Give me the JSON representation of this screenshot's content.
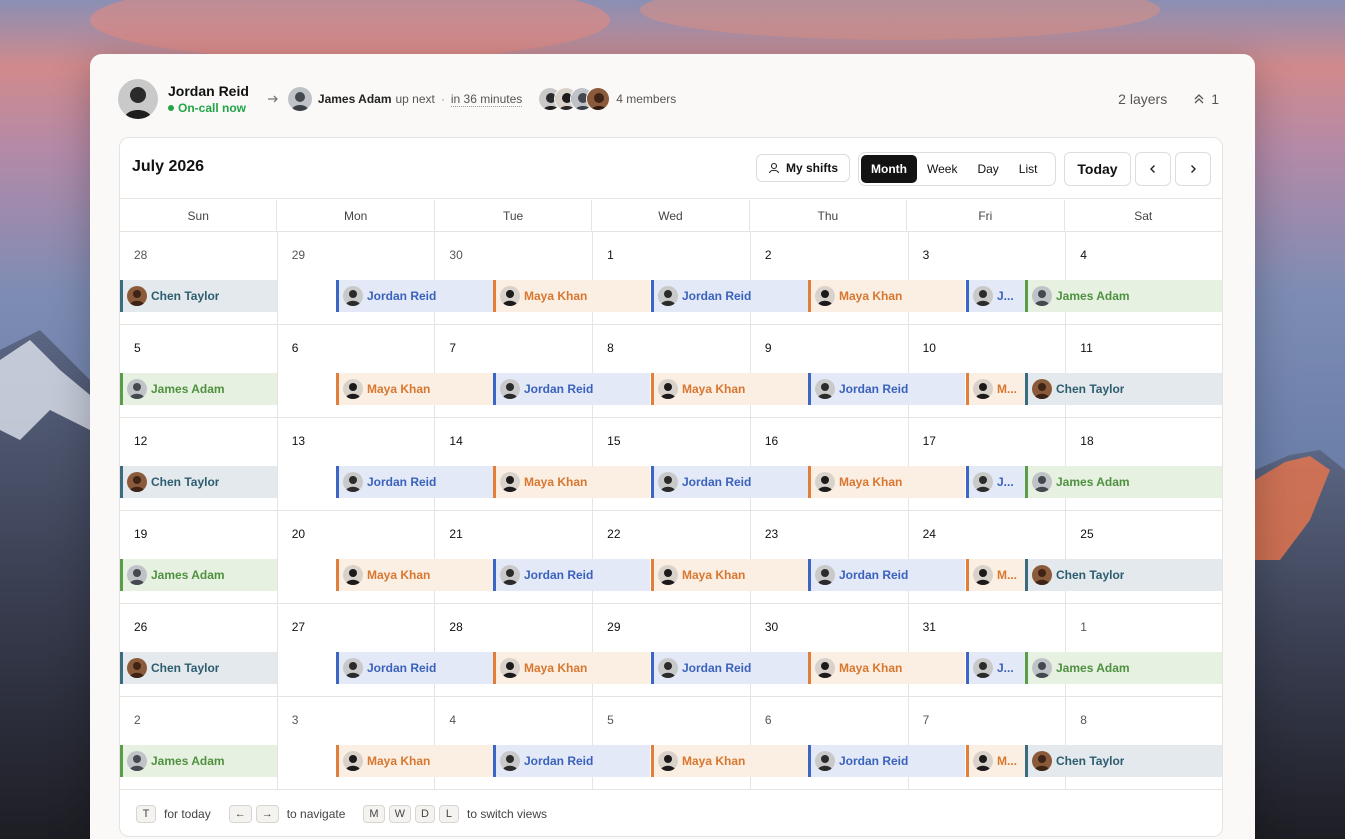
{
  "oncall": {
    "name": "Jordan Reid",
    "status": "On-call now",
    "next_name": "James Adam",
    "next_suffix": "up next",
    "next_sep": "·",
    "next_time": "in 36 minutes",
    "members_label": "4 members",
    "layers_label": "2 layers",
    "escalation_count": "1"
  },
  "calendar": {
    "month_label": "July 2026",
    "my_shifts_label": "My shifts",
    "views": [
      "Month",
      "Week",
      "Day",
      "List"
    ],
    "active_view": "Month",
    "today_label": "Today",
    "weekdays": [
      "Sun",
      "Mon",
      "Tue",
      "Wed",
      "Thu",
      "Fri",
      "Sat"
    ],
    "weeks": [
      {
        "days": [
          "28",
          "29",
          "30",
          "1",
          "2",
          "3",
          "4"
        ],
        "muted": [
          true,
          true,
          true,
          false,
          false,
          false,
          false
        ],
        "shifts": [
          [
            "chen",
            "Chen Taylor"
          ],
          [
            "jordan",
            "Jordan Reid"
          ],
          [
            "maya",
            "Maya Khan"
          ],
          [
            "jordan",
            "Jordan Reid"
          ],
          [
            "maya",
            "Maya Khan"
          ],
          [
            "jordan",
            "J..."
          ],
          [
            "james",
            "James Adam"
          ]
        ]
      },
      {
        "days": [
          "5",
          "6",
          "7",
          "8",
          "9",
          "10",
          "11"
        ],
        "muted": [
          false,
          false,
          false,
          false,
          false,
          false,
          false
        ],
        "shifts": [
          [
            "james",
            "James Adam"
          ],
          [
            "maya",
            "Maya Khan"
          ],
          [
            "jordan",
            "Jordan Reid"
          ],
          [
            "maya",
            "Maya Khan"
          ],
          [
            "jordan",
            "Jordan Reid"
          ],
          [
            "maya",
            "M..."
          ],
          [
            "chen",
            "Chen Taylor"
          ]
        ]
      },
      {
        "days": [
          "12",
          "13",
          "14",
          "15",
          "16",
          "17",
          "18"
        ],
        "muted": [
          false,
          false,
          false,
          false,
          false,
          false,
          false
        ],
        "shifts": [
          [
            "chen",
            "Chen Taylor"
          ],
          [
            "jordan",
            "Jordan Reid"
          ],
          [
            "maya",
            "Maya Khan"
          ],
          [
            "jordan",
            "Jordan Reid"
          ],
          [
            "maya",
            "Maya Khan"
          ],
          [
            "jordan",
            "J..."
          ],
          [
            "james",
            "James Adam"
          ]
        ]
      },
      {
        "days": [
          "19",
          "20",
          "21",
          "22",
          "23",
          "24",
          "25"
        ],
        "muted": [
          false,
          false,
          false,
          false,
          false,
          false,
          false
        ],
        "shifts": [
          [
            "james",
            "James Adam"
          ],
          [
            "maya",
            "Maya Khan"
          ],
          [
            "jordan",
            "Jordan Reid"
          ],
          [
            "maya",
            "Maya Khan"
          ],
          [
            "jordan",
            "Jordan Reid"
          ],
          [
            "maya",
            "M..."
          ],
          [
            "chen",
            "Chen Taylor"
          ]
        ]
      },
      {
        "days": [
          "26",
          "27",
          "28",
          "29",
          "30",
          "31",
          "1"
        ],
        "muted": [
          false,
          false,
          false,
          false,
          false,
          false,
          true
        ],
        "shifts": [
          [
            "chen",
            "Chen Taylor"
          ],
          [
            "jordan",
            "Jordan Reid"
          ],
          [
            "maya",
            "Maya Khan"
          ],
          [
            "jordan",
            "Jordan Reid"
          ],
          [
            "maya",
            "Maya Khan"
          ],
          [
            "jordan",
            "J..."
          ],
          [
            "james",
            "James Adam"
          ]
        ]
      },
      {
        "days": [
          "2",
          "3",
          "4",
          "5",
          "6",
          "7",
          "8"
        ],
        "muted": [
          true,
          true,
          true,
          true,
          true,
          true,
          true
        ],
        "shifts": [
          [
            "james",
            "James Adam"
          ],
          [
            "maya",
            "Maya Khan"
          ],
          [
            "jordan",
            "Jordan Reid"
          ],
          [
            "maya",
            "Maya Khan"
          ],
          [
            "jordan",
            "Jordan Reid"
          ],
          [
            "maya",
            "M..."
          ],
          [
            "chen",
            "Chen Taylor"
          ]
        ]
      }
    ]
  },
  "footer": {
    "today_key": "T",
    "today_text": "for today",
    "prev_key": "←",
    "next_key": "→",
    "nav_text": "to navigate",
    "view_keys": [
      "M",
      "W",
      "D",
      "L"
    ],
    "views_text": "to switch views"
  },
  "colors": {
    "chen": "#3b6b7e",
    "jordan": "#3c66c4",
    "maya": "#e07f3c",
    "james": "#5a9c48",
    "oncall_green": "#22a447"
  },
  "icons": [
    "arrow-right-icon",
    "user-icon",
    "chevron-left-icon",
    "chevron-right-icon",
    "chevrons-up-icon"
  ]
}
